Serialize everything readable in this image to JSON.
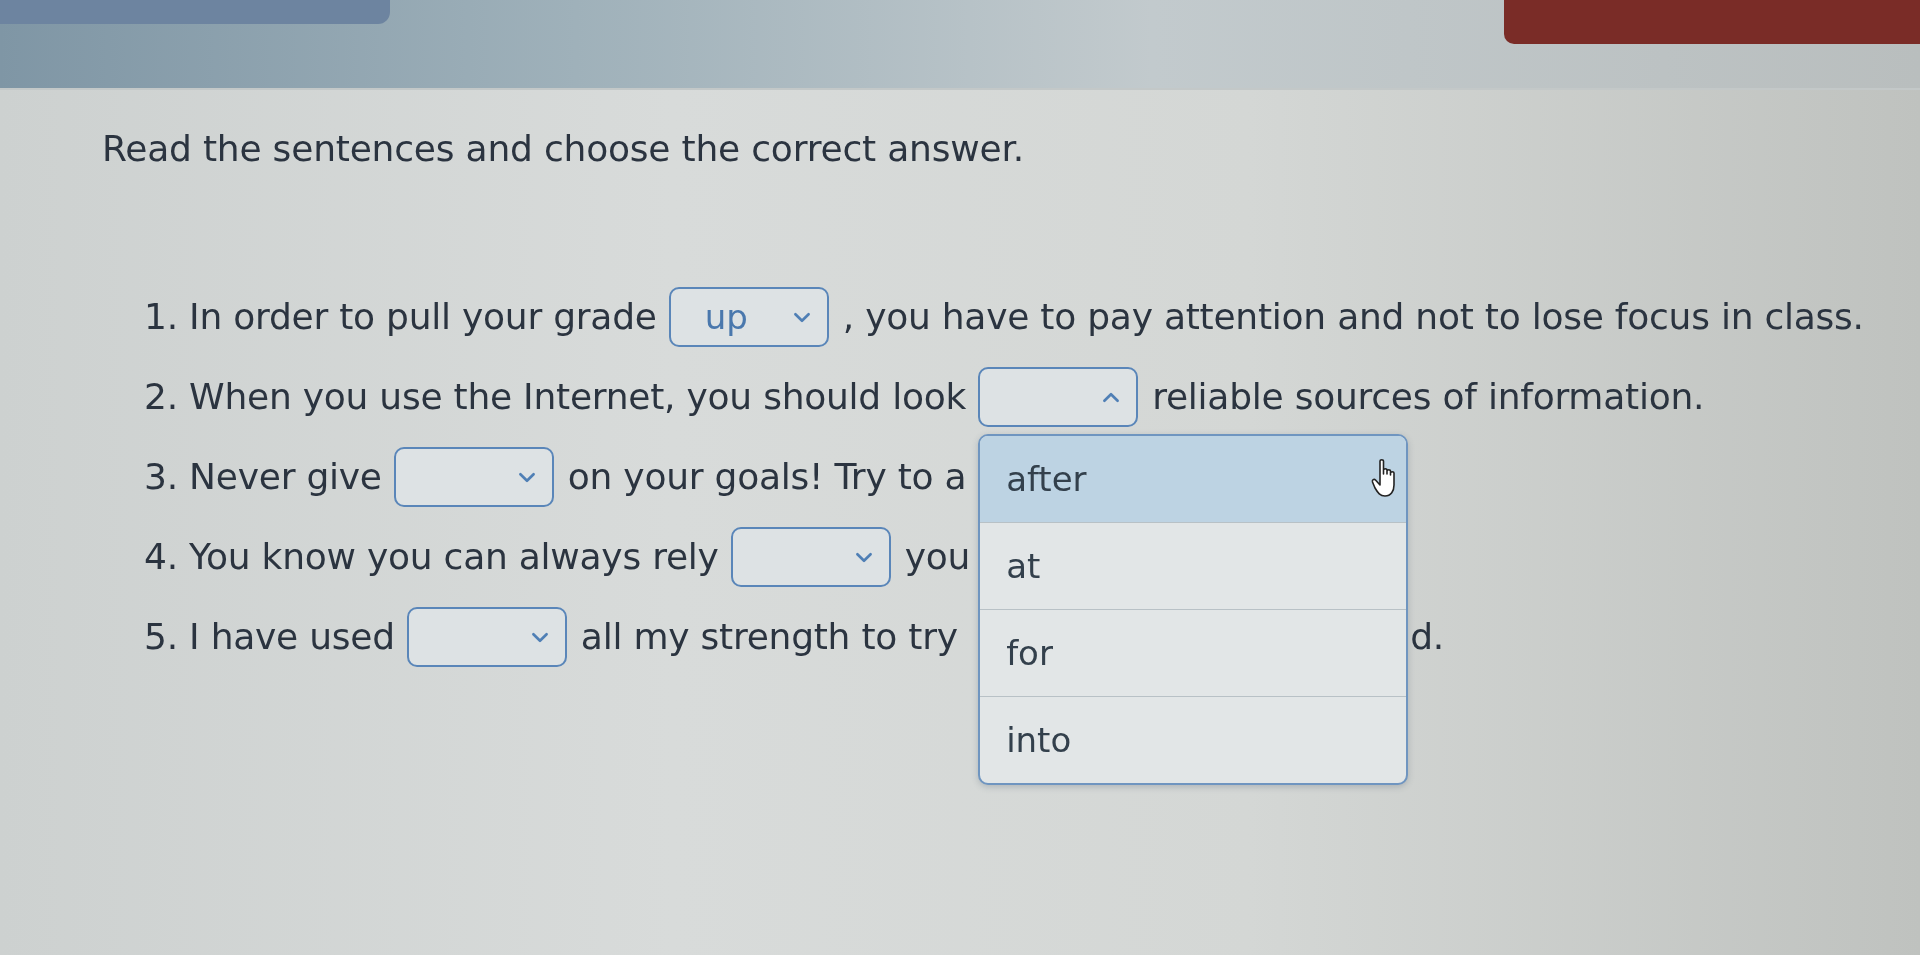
{
  "instruction": "Read the sentences and choose the correct answer.",
  "sentences": [
    {
      "parts": [
        {
          "kind": "text",
          "text": "1. In order to pull your grade"
        },
        {
          "kind": "select",
          "value": "up",
          "expanded": false
        },
        {
          "kind": "text",
          "text": ", you have to pay attention and not to lose focus in class."
        }
      ]
    },
    {
      "parts": [
        {
          "kind": "text",
          "text": "2. When you use the Internet, you should look"
        },
        {
          "kind": "select",
          "expanded": true,
          "options": [
            {
              "label": "after",
              "highlighted": true
            },
            {
              "label": "at",
              "highlighted": false
            },
            {
              "label": "for",
              "highlighted": false
            },
            {
              "label": "into",
              "highlighted": false
            }
          ]
        },
        {
          "kind": "text",
          "text": "reliable sources of information."
        }
      ]
    },
    {
      "parts": [
        {
          "kind": "text",
          "text": "3. Never give"
        },
        {
          "kind": "select",
          "expanded": false
        },
        {
          "kind": "text",
          "text": "on your goals! Try to a"
        }
      ]
    },
    {
      "parts": [
        {
          "kind": "text",
          "text": "4. You know you can always rely"
        },
        {
          "kind": "select",
          "expanded": false
        },
        {
          "kind": "text",
          "text": "you"
        }
      ]
    },
    {
      "parts": [
        {
          "kind": "text",
          "text": "5. I have used"
        },
        {
          "kind": "select",
          "expanded": false
        },
        {
          "kind": "text",
          "text": "all my strength to try"
        },
        {
          "kind": "covered"
        },
        {
          "kind": "text",
          "text": "d."
        }
      ]
    }
  ]
}
